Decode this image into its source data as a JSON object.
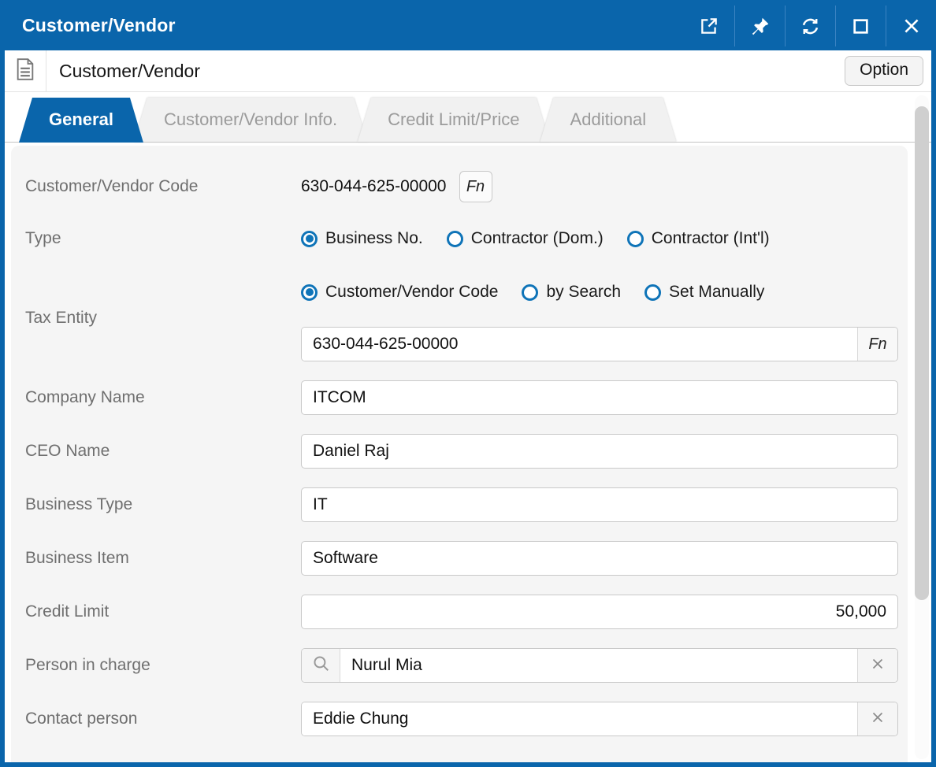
{
  "window": {
    "title": "Customer/Vendor"
  },
  "titlebar": {
    "icons": [
      "open-new-window",
      "pin",
      "refresh",
      "maximize",
      "close"
    ]
  },
  "header": {
    "title": "Customer/Vendor",
    "option_label": "Option"
  },
  "tabs": [
    {
      "label": "General",
      "active": true
    },
    {
      "label": "Customer/Vendor Info.",
      "active": false
    },
    {
      "label": "Credit Limit/Price",
      "active": false
    },
    {
      "label": "Additional",
      "active": false
    }
  ],
  "form": {
    "code": {
      "label": "Customer/Vendor Code",
      "value": "630-044-625-00000",
      "fn_label": "Fn"
    },
    "type": {
      "label": "Type",
      "options": [
        "Business No.",
        "Contractor (Dom.)",
        "Contractor (Int'l)"
      ],
      "selected": "Business No."
    },
    "tax_entity": {
      "label": "Tax Entity",
      "options": [
        "Customer/Vendor Code",
        "by Search",
        "Set Manually"
      ],
      "selected": "Customer/Vendor Code",
      "value": "630-044-625-00000",
      "fn_label": "Fn"
    },
    "company_name": {
      "label": "Company Name",
      "value": "ITCOM"
    },
    "ceo_name": {
      "label": "CEO Name",
      "value": "Daniel Raj"
    },
    "business_type": {
      "label": "Business Type",
      "value": "IT"
    },
    "business_item": {
      "label": "Business Item",
      "value": "Software"
    },
    "credit_limit": {
      "label": "Credit Limit",
      "value": "50,000"
    },
    "person_in_charge": {
      "label": "Person in charge",
      "value": "Nurul Mia"
    },
    "contact_person": {
      "label": "Contact person",
      "value": "Eddie Chung"
    }
  },
  "colors": {
    "accent_blue": "#0a65ab",
    "radio_blue": "#0f74b8",
    "panel_bg": "#f5f5f5",
    "inactive_tab_bg": "#f1f1f1",
    "inactive_tab_text": "#9b9b9b",
    "label_text": "#6f6f6f",
    "input_border": "#c9c9c9",
    "scrollbar_thumb": "#cfcfcf"
  }
}
